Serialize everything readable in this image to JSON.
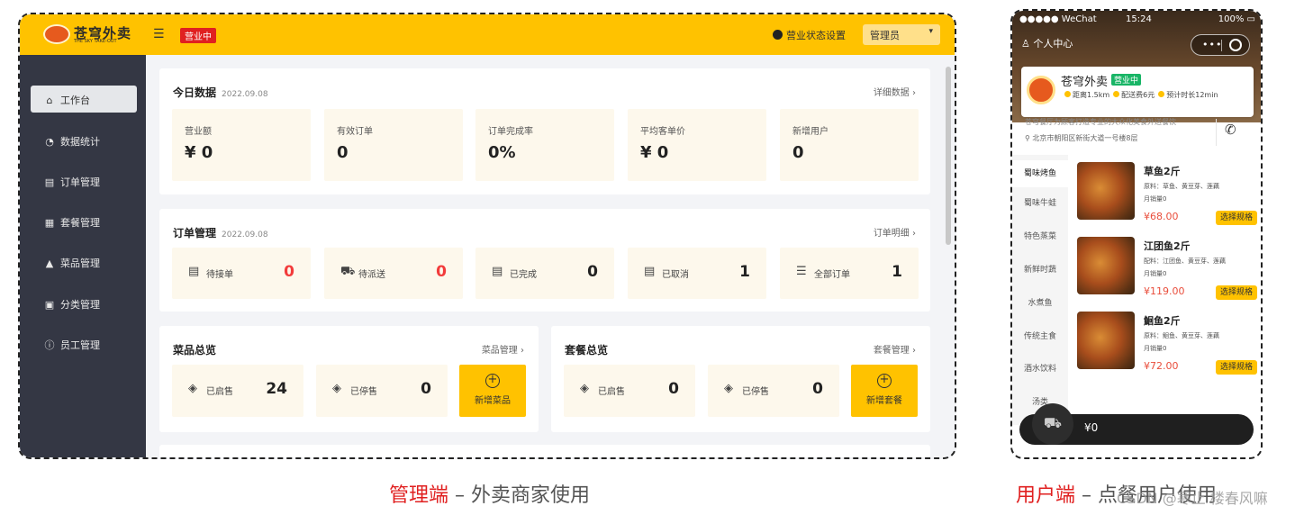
{
  "admin": {
    "logo": {
      "name": "苍穹外卖",
      "subtitle": "THE SKY TAKE-OUT"
    },
    "status_tag": "营业中",
    "status_setting": "营业状态设置",
    "user_select": "管理员",
    "sidebar": [
      {
        "icon": "home-icon",
        "label": "工作台",
        "active": true
      },
      {
        "icon": "chart-icon",
        "label": "数据统计"
      },
      {
        "icon": "order-icon",
        "label": "订单管理"
      },
      {
        "icon": "gift-icon",
        "label": "套餐管理"
      },
      {
        "icon": "dish-icon",
        "label": "菜品管理"
      },
      {
        "icon": "category-icon",
        "label": "分类管理"
      },
      {
        "icon": "employee-icon",
        "label": "员工管理"
      }
    ],
    "today": {
      "title": "今日数据",
      "date": "2022.09.08",
      "link": "详细数据",
      "stats": [
        {
          "label": "营业额",
          "value": "¥ 0"
        },
        {
          "label": "有效订单",
          "value": "0"
        },
        {
          "label": "订单完成率",
          "value": "0%"
        },
        {
          "label": "平均客单价",
          "value": "¥ 0"
        },
        {
          "label": "新增用户",
          "value": "0"
        }
      ]
    },
    "orders": {
      "title": "订单管理",
      "date": "2022.09.08",
      "link": "订单明细",
      "items": [
        {
          "label": "待接单",
          "value": "0",
          "highlight": true
        },
        {
          "label": "待派送",
          "value": "0",
          "highlight": true
        },
        {
          "label": "已完成",
          "value": "0"
        },
        {
          "label": "已取消",
          "value": "1"
        },
        {
          "label": "全部订单",
          "value": "1"
        }
      ]
    },
    "dishes": {
      "title": "菜品总览",
      "link": "菜品管理",
      "on_label": "已启售",
      "on_value": "24",
      "off_label": "已停售",
      "off_value": "0",
      "add_label": "新增菜品"
    },
    "setmeals": {
      "title": "套餐总览",
      "link": "套餐管理",
      "on_label": "已启售",
      "on_value": "0",
      "off_label": "已停售",
      "off_value": "0",
      "add_label": "新增套餐"
    }
  },
  "phone": {
    "status": {
      "carrier": "●●●●● WeChat",
      "time": "15:24",
      "battery": "100%"
    },
    "personal_center": "个人中心",
    "store": {
      "name": "苍穹外卖",
      "tag": "营业中",
      "distance": "距离1.5km",
      "fee": "配送费6元",
      "eta": "预计时长12min",
      "desc": "苍穹餐厅为顾客打造专业的大众化美食外送餐饮",
      "address": "北京市朝阳区新街大道一号楼8层"
    },
    "categories": [
      "蜀味烤鱼",
      "蜀味牛蛙",
      "特色蒸菜",
      "新鲜时蔬",
      "水煮鱼",
      "传统主食",
      "酒水饮料",
      "汤类"
    ],
    "dishes": [
      {
        "name": "草鱼2斤",
        "desc": "原料：草鱼、黄豆芽、莲藕",
        "sold": "月销量0",
        "price": "¥68.00",
        "button": "选择规格"
      },
      {
        "name": "江团鱼2斤",
        "desc": "配料：江团鱼、黄豆芽、莲藕",
        "sold": "月销量0",
        "price": "¥119.00",
        "button": "选择规格"
      },
      {
        "name": "鮰鱼2斤",
        "desc": "原料：鮰鱼、黄豆芽、莲藕",
        "sold": "月销量0",
        "price": "¥72.00",
        "button": "选择规格"
      }
    ],
    "cart_total": "¥0"
  },
  "captions": {
    "admin_hl": "管理端",
    "admin_rest": " – 外卖商家使用",
    "user_hl": "用户端",
    "user_rest": " – 点餐用户使用"
  },
  "watermark": "CSDN @寒止 楼春风嘛",
  "colors": {
    "brand": "#ffc200",
    "sidebar": "#343744",
    "alert": "#f23b3b"
  }
}
